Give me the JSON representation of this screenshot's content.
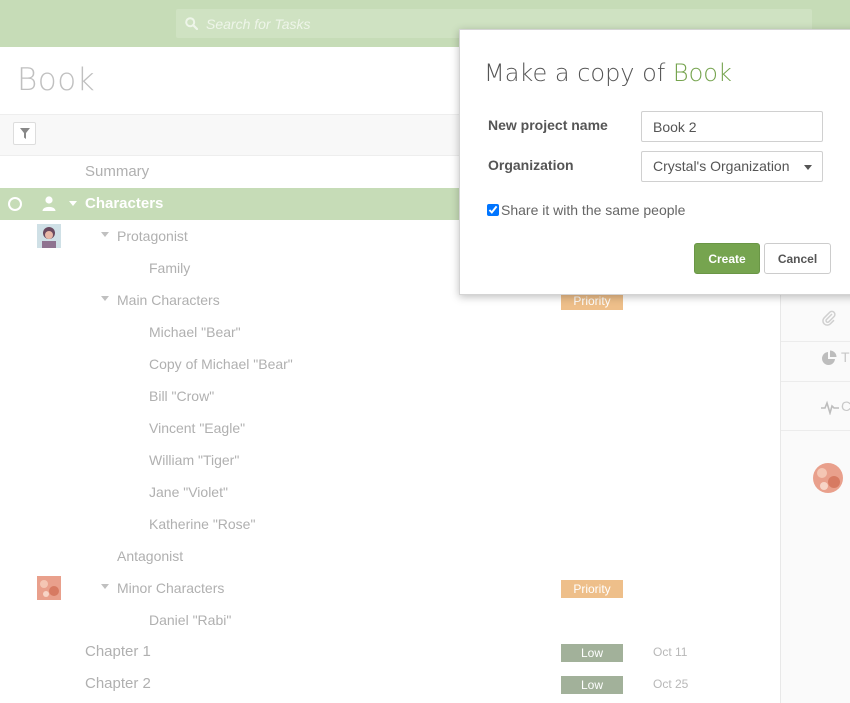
{
  "search": {
    "placeholder": "Search for Tasks"
  },
  "page": {
    "title": "Book"
  },
  "tasks": [
    {
      "label": "Summary"
    },
    {
      "label": "Characters"
    },
    {
      "label": "Protagonist"
    },
    {
      "label": "Family"
    },
    {
      "label": "Main Characters",
      "badge": "Priority"
    },
    {
      "label": "Michael \"Bear\""
    },
    {
      "label": "Copy of Michael \"Bear\""
    },
    {
      "label": "Bill \"Crow\""
    },
    {
      "label": "Vincent \"Eagle\""
    },
    {
      "label": "William \"Tiger\""
    },
    {
      "label": "Jane \"Violet\""
    },
    {
      "label": "Katherine \"Rose\""
    },
    {
      "label": "Antagonist"
    },
    {
      "label": "Minor Characters",
      "badge": "Priority"
    },
    {
      "label": "Daniel \"Rabi\""
    },
    {
      "label": "Chapter 1",
      "badge": "Low",
      "due": "Oct 11"
    },
    {
      "label": "Chapter 2",
      "badge": "Low",
      "due": "Oct 25"
    }
  ],
  "side_panel": {
    "items": [
      {
        "icon": "paperclip-icon",
        "label": ""
      },
      {
        "icon": "pie-chart-icon",
        "label": "T"
      },
      {
        "icon": "activity-icon",
        "label": "C"
      }
    ]
  },
  "colors": {
    "brand_green": "#76a44f",
    "topbar": "#c6dcb7",
    "priority": "#eebf8a",
    "low": "#a2b19a"
  },
  "dialog": {
    "title_prefix": "Make a copy of",
    "title_project": "Book",
    "name_label": "New project name",
    "name_value": "Book 2",
    "org_label": "Organization",
    "org_value": "Crystal's Organization",
    "share_label": "Share it with the same people",
    "share_checked": true,
    "create_label": "Create",
    "cancel_label": "Cancel"
  }
}
